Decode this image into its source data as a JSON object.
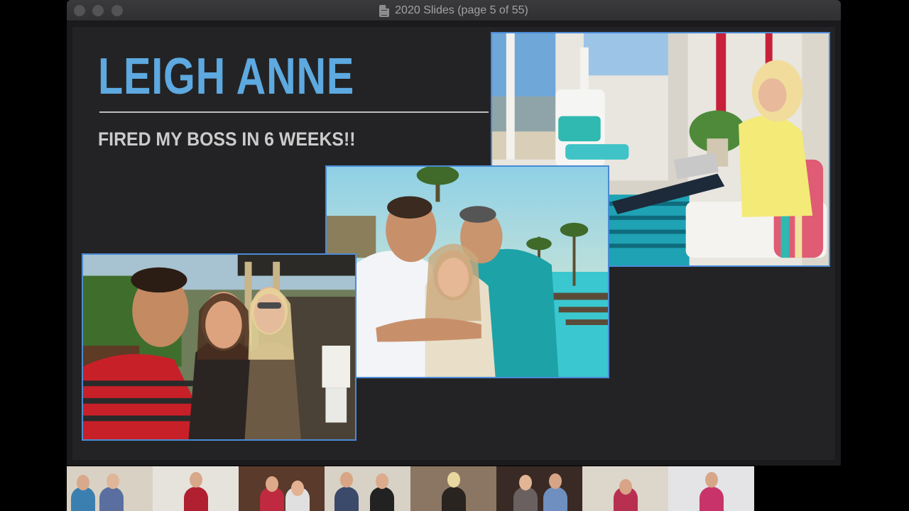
{
  "window": {
    "title": "2020 Slides (page 5 of 55)",
    "doc_icon": "preview-document-icon"
  },
  "slide": {
    "name": "LEIGH ANNE",
    "tagline": "FIRED MY BOSS IN 6 WEEKS!!",
    "accent_color": "#5da9e0",
    "photo_border_color": "#4a8ad6"
  },
  "gallery": {
    "participant_count": 8
  }
}
